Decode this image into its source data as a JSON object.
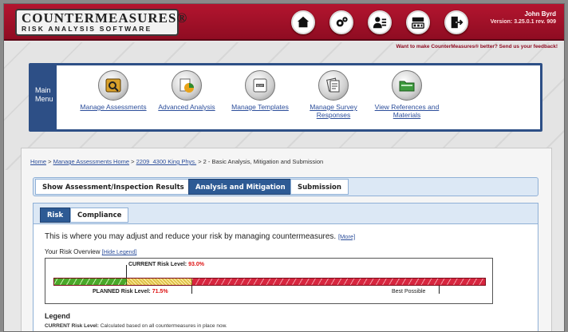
{
  "header": {
    "logo_title": "COUNTERMEASURES®",
    "logo_subtitle": "RISK ANALYSIS SOFTWARE",
    "icons": [
      "home-icon",
      "settings-icon",
      "users-icon",
      "new-feature-icon",
      "logout-icon"
    ],
    "user_name": "John Byrd",
    "version": "Version: 3.25.0.1 rev. 909",
    "feedback": "Want to make CounterMeasures® better? Send us your feedback!"
  },
  "main_menu": {
    "label": "Main Menu",
    "items": [
      {
        "label": "Manage Assessments",
        "icon": "assessment-icon"
      },
      {
        "label": "Advanced Analysis",
        "icon": "chart-pie-icon"
      },
      {
        "label": "Manage Templates",
        "icon": "edit-icon"
      },
      {
        "label": "Manage Survey Responses",
        "icon": "survey-icon"
      },
      {
        "label": "View References and Materials",
        "icon": "folder-icon"
      }
    ]
  },
  "breadcrumb": {
    "home": "Home",
    "sep": ">",
    "link1": "Manage Assessments Home",
    "link2": "2209_4300 King Phys.",
    "current": "> 2 - Basic Analysis, Mitigation and Submission"
  },
  "tabs": [
    {
      "label": "Show Assessment/Inspection Results",
      "active": false
    },
    {
      "label": "Analysis and Mitigation",
      "active": true
    },
    {
      "label": "Submission",
      "active": false
    }
  ],
  "subtabs": [
    {
      "label": "Risk",
      "active": true
    },
    {
      "label": "Compliance",
      "active": false
    }
  ],
  "intro": {
    "text": "This is where you may adjust and reduce your risk by managing countermeasures.",
    "more": "[More]"
  },
  "overview": {
    "title": "Your Risk Overview",
    "hide_legend": "[Hide Legend]"
  },
  "risk": {
    "current_label": "CURRENT Risk Level:",
    "current_value": "93.0%",
    "current_fraction": 0.93,
    "planned_label": "PLANNED Risk Level:",
    "planned_value": "71.5%",
    "planned_fraction": 0.715,
    "best_label": "Best Possible",
    "colors": {
      "green": "#4aa82a",
      "yellow": "#e0c14a",
      "red": "#d7263f"
    }
  },
  "legend": {
    "title": "Legend",
    "current_line_label": "CURRENT Risk Level:",
    "current_line_text": "Calculated based on all countermeasures in place now."
  }
}
